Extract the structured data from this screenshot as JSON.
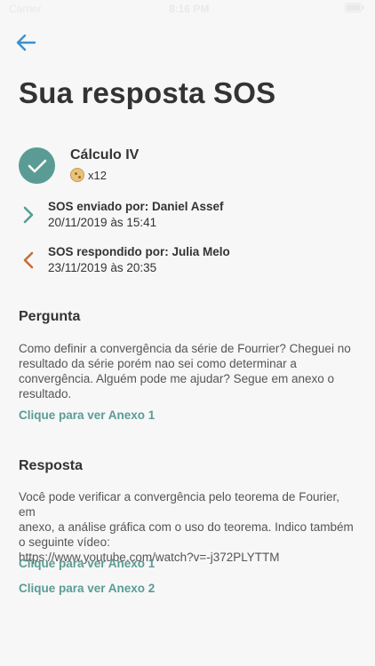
{
  "status_bar": {
    "carrier": "Carrier",
    "time": "8:16 PM"
  },
  "header": {
    "back_icon": "arrow-left-icon",
    "title": "Sua resposta SOS"
  },
  "course": {
    "icon": "check-circle-icon",
    "name": "Cálculo IV",
    "coin_icon": "cookie-icon",
    "coins": "x12"
  },
  "sent": {
    "icon": "chevron-right-icon",
    "label": "SOS enviado por: Daniel Assef",
    "date": "20/11/2019 às 15:41"
  },
  "answered": {
    "icon": "chevron-left-icon",
    "label": "SOS respondido por: Julia Melo",
    "date": "23/11/2019 às 20:35"
  },
  "question": {
    "heading": "Pergunta",
    "lines": [
      "Como definir a convergência da série de Fourrier? Cheguei no",
      "resultado da série porém nao sei como determinar a",
      "convergência. Alguém pode me ajudar? Segue em anexo o",
      "resultado."
    ],
    "attachment_link": "Clique para ver Anexo 1"
  },
  "answer": {
    "heading": "Resposta",
    "lines": [
      "Você pode verificar a convergência pelo teorema de Fourier, em",
      "anexo, a análise gráfica com o uso do teorema. Indico também",
      "o seguinte vídeo:",
      "https://www.youtube.com/watch?v=-j372PLYTTM"
    ],
    "attachment_link_1": "Clique para ver Anexo 1",
    "attachment_link_2": "Clique para ver Anexo 2"
  },
  "colors": {
    "accent": "#5a9c95",
    "back_arrow": "#3b8fd0",
    "answered_arrow": "#c56f34",
    "background": "#f7f7f7"
  }
}
